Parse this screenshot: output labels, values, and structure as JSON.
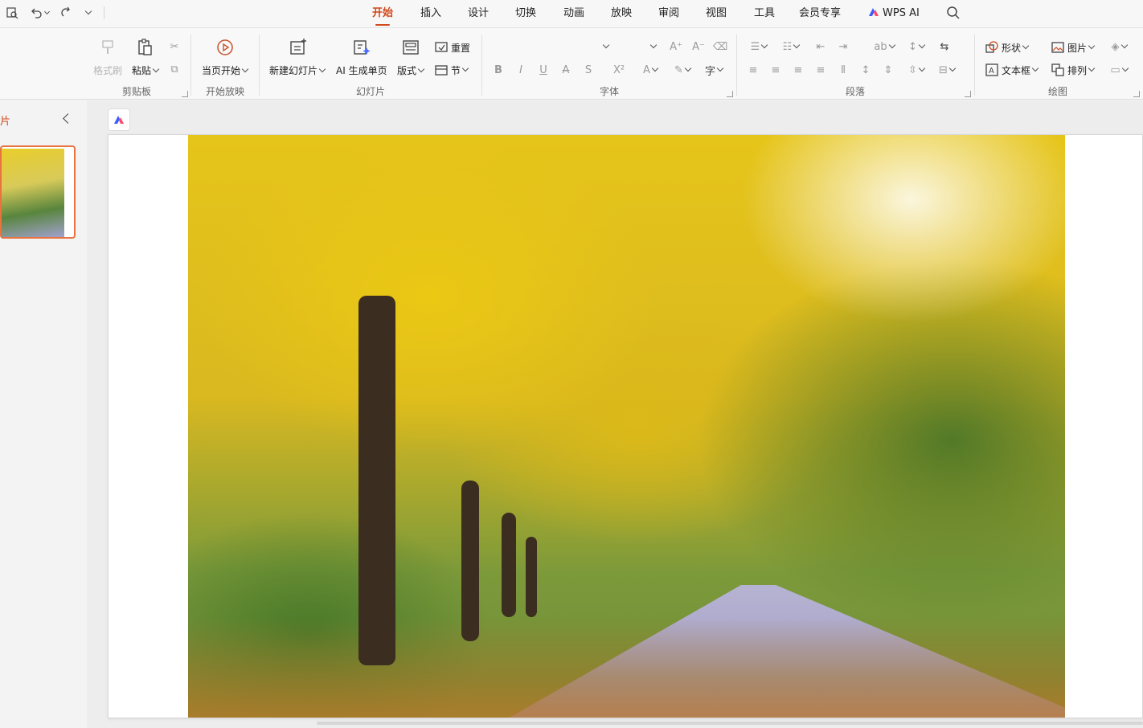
{
  "menubar": {
    "quick_access": [
      "preview-icon",
      "undo-icon",
      "redo-icon",
      "customize-icon"
    ],
    "tabs": [
      {
        "label": "开始",
        "active": true
      },
      {
        "label": "插入",
        "active": false
      },
      {
        "label": "设计",
        "active": false
      },
      {
        "label": "切换",
        "active": false
      },
      {
        "label": "动画",
        "active": false
      },
      {
        "label": "放映",
        "active": false
      },
      {
        "label": "审阅",
        "active": false
      },
      {
        "label": "视图",
        "active": false
      },
      {
        "label": "工具",
        "active": false
      },
      {
        "label": "会员专享",
        "active": false
      },
      {
        "label": "WPS AI",
        "active": false
      }
    ]
  },
  "ribbon": {
    "clipboard": {
      "group_label": "剪贴板",
      "format_painter": "格式刷",
      "paste": "粘贴"
    },
    "slideshow": {
      "group_label": "开始放映",
      "from_current": "当页开始"
    },
    "slides": {
      "group_label": "幻灯片",
      "new_slide": "新建幻灯片",
      "ai_page": "AI 生成单页",
      "layout": "版式",
      "reset": "重置",
      "section": "节"
    },
    "font": {
      "group_label": "字体",
      "bold": "B",
      "italic": "I",
      "underline": "U",
      "strike": "A",
      "shadow": "S",
      "superscript": "X²"
    },
    "paragraph": {
      "group_label": "段落"
    },
    "drawing": {
      "group_label": "绘图",
      "shape": "形状",
      "picture": "图片",
      "textbox": "文本框",
      "arrange": "排列"
    }
  },
  "panel": {
    "tab_label": "片"
  },
  "colors": {
    "accent": "#d2481c",
    "thumb_border": "#e8733f"
  }
}
